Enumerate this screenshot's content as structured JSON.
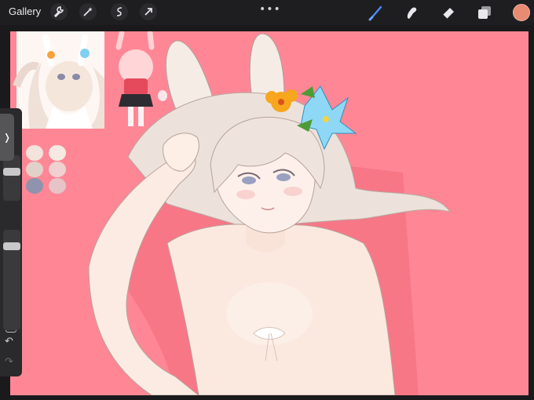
{
  "app": {
    "gallery_label": "Gallery",
    "more_label": "•••"
  },
  "toolbar": {
    "left_tools": [
      "wrench-icon",
      "magic-wand-icon",
      "selection-icon",
      "transform-arrow-icon"
    ],
    "right_tools": [
      "brush-icon",
      "smudge-icon",
      "eraser-icon",
      "layers-icon"
    ],
    "active_tool": "brush-icon",
    "current_color": "#e88b73"
  },
  "canvas": {
    "background_color": "#ff8795",
    "subject": "bunny-eared girl with flower crown"
  },
  "sidebar": {
    "brush_size_icon": "slider",
    "opacity_icon": "slider",
    "modify_button_icon": "square-icon",
    "undo_icon": "undo-icon",
    "redo_icon": "redo-icon"
  },
  "reference_palette": [
    "#f3e3da",
    "#f7e9e2",
    "#e2d1c8",
    "#f0d0d0",
    "#8f93ad",
    "#e6c3c7"
  ]
}
